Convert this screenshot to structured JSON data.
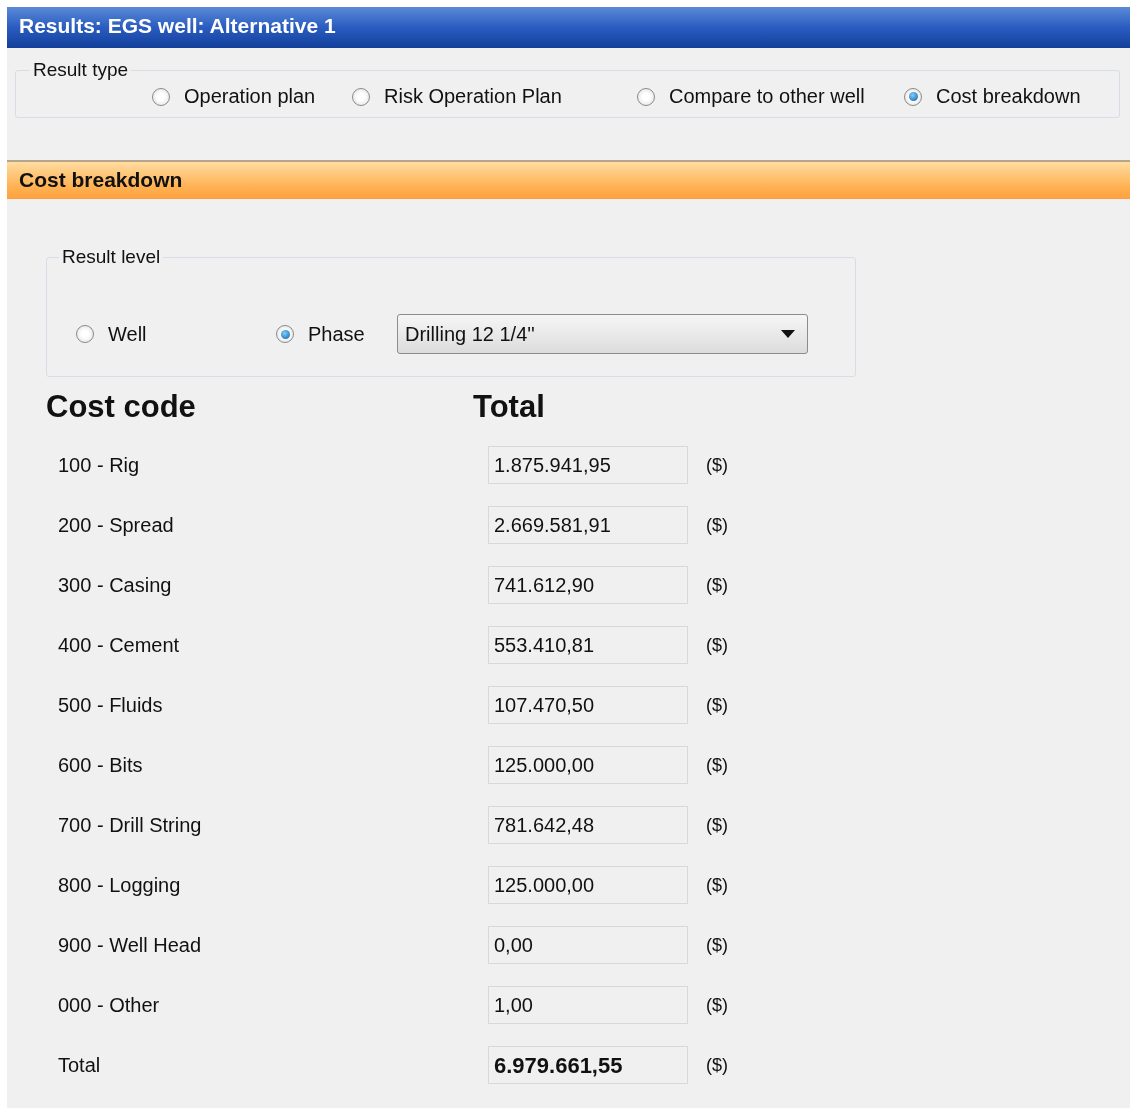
{
  "window": {
    "title": "Results: EGS well: Alternative 1"
  },
  "result_type": {
    "label": "Result type",
    "options": [
      {
        "label": "Operation plan",
        "selected": false
      },
      {
        "label": "Risk Operation Plan",
        "selected": false
      },
      {
        "label": "Compare to other well",
        "selected": false
      },
      {
        "label": "Cost breakdown",
        "selected": true
      }
    ]
  },
  "section": {
    "title": "Cost breakdown"
  },
  "result_level": {
    "label": "Result level",
    "options": [
      {
        "label": "Well",
        "selected": false
      },
      {
        "label": "Phase",
        "selected": true
      }
    ],
    "dropdown": {
      "value": "Drilling 12 1/4''"
    }
  },
  "table": {
    "columns": [
      "Cost code",
      "Total"
    ],
    "rows": [
      {
        "kind": "item",
        "code": "100 - Rig",
        "value": "1.875.941,95",
        "unit": "($)"
      },
      {
        "kind": "item",
        "code": "200 - Spread",
        "value": "2.669.581,91",
        "unit": "($)"
      },
      {
        "kind": "item",
        "code": "300 - Casing",
        "value": "741.612,90",
        "unit": "($)"
      },
      {
        "kind": "item",
        "code": "400 - Cement",
        "value": "553.410,81",
        "unit": "($)"
      },
      {
        "kind": "item",
        "code": "500 - Fluids",
        "value": "107.470,50",
        "unit": "($)"
      },
      {
        "kind": "item",
        "code": "600 - Bits",
        "value": "125.000,00",
        "unit": "($)"
      },
      {
        "kind": "item",
        "code": "700 - Drill String",
        "value": "781.642,48",
        "unit": "($)"
      },
      {
        "kind": "item",
        "code": "800 - Logging",
        "value": "125.000,00",
        "unit": "($)"
      },
      {
        "kind": "item",
        "code": "900 - Well Head",
        "value": "0,00",
        "unit": "($)"
      },
      {
        "kind": "item",
        "code": "000 - Other",
        "value": "1,00",
        "unit": "($)"
      },
      {
        "kind": "total",
        "code": "Total",
        "value": "6.979.661,55",
        "unit": "($)"
      }
    ]
  }
}
